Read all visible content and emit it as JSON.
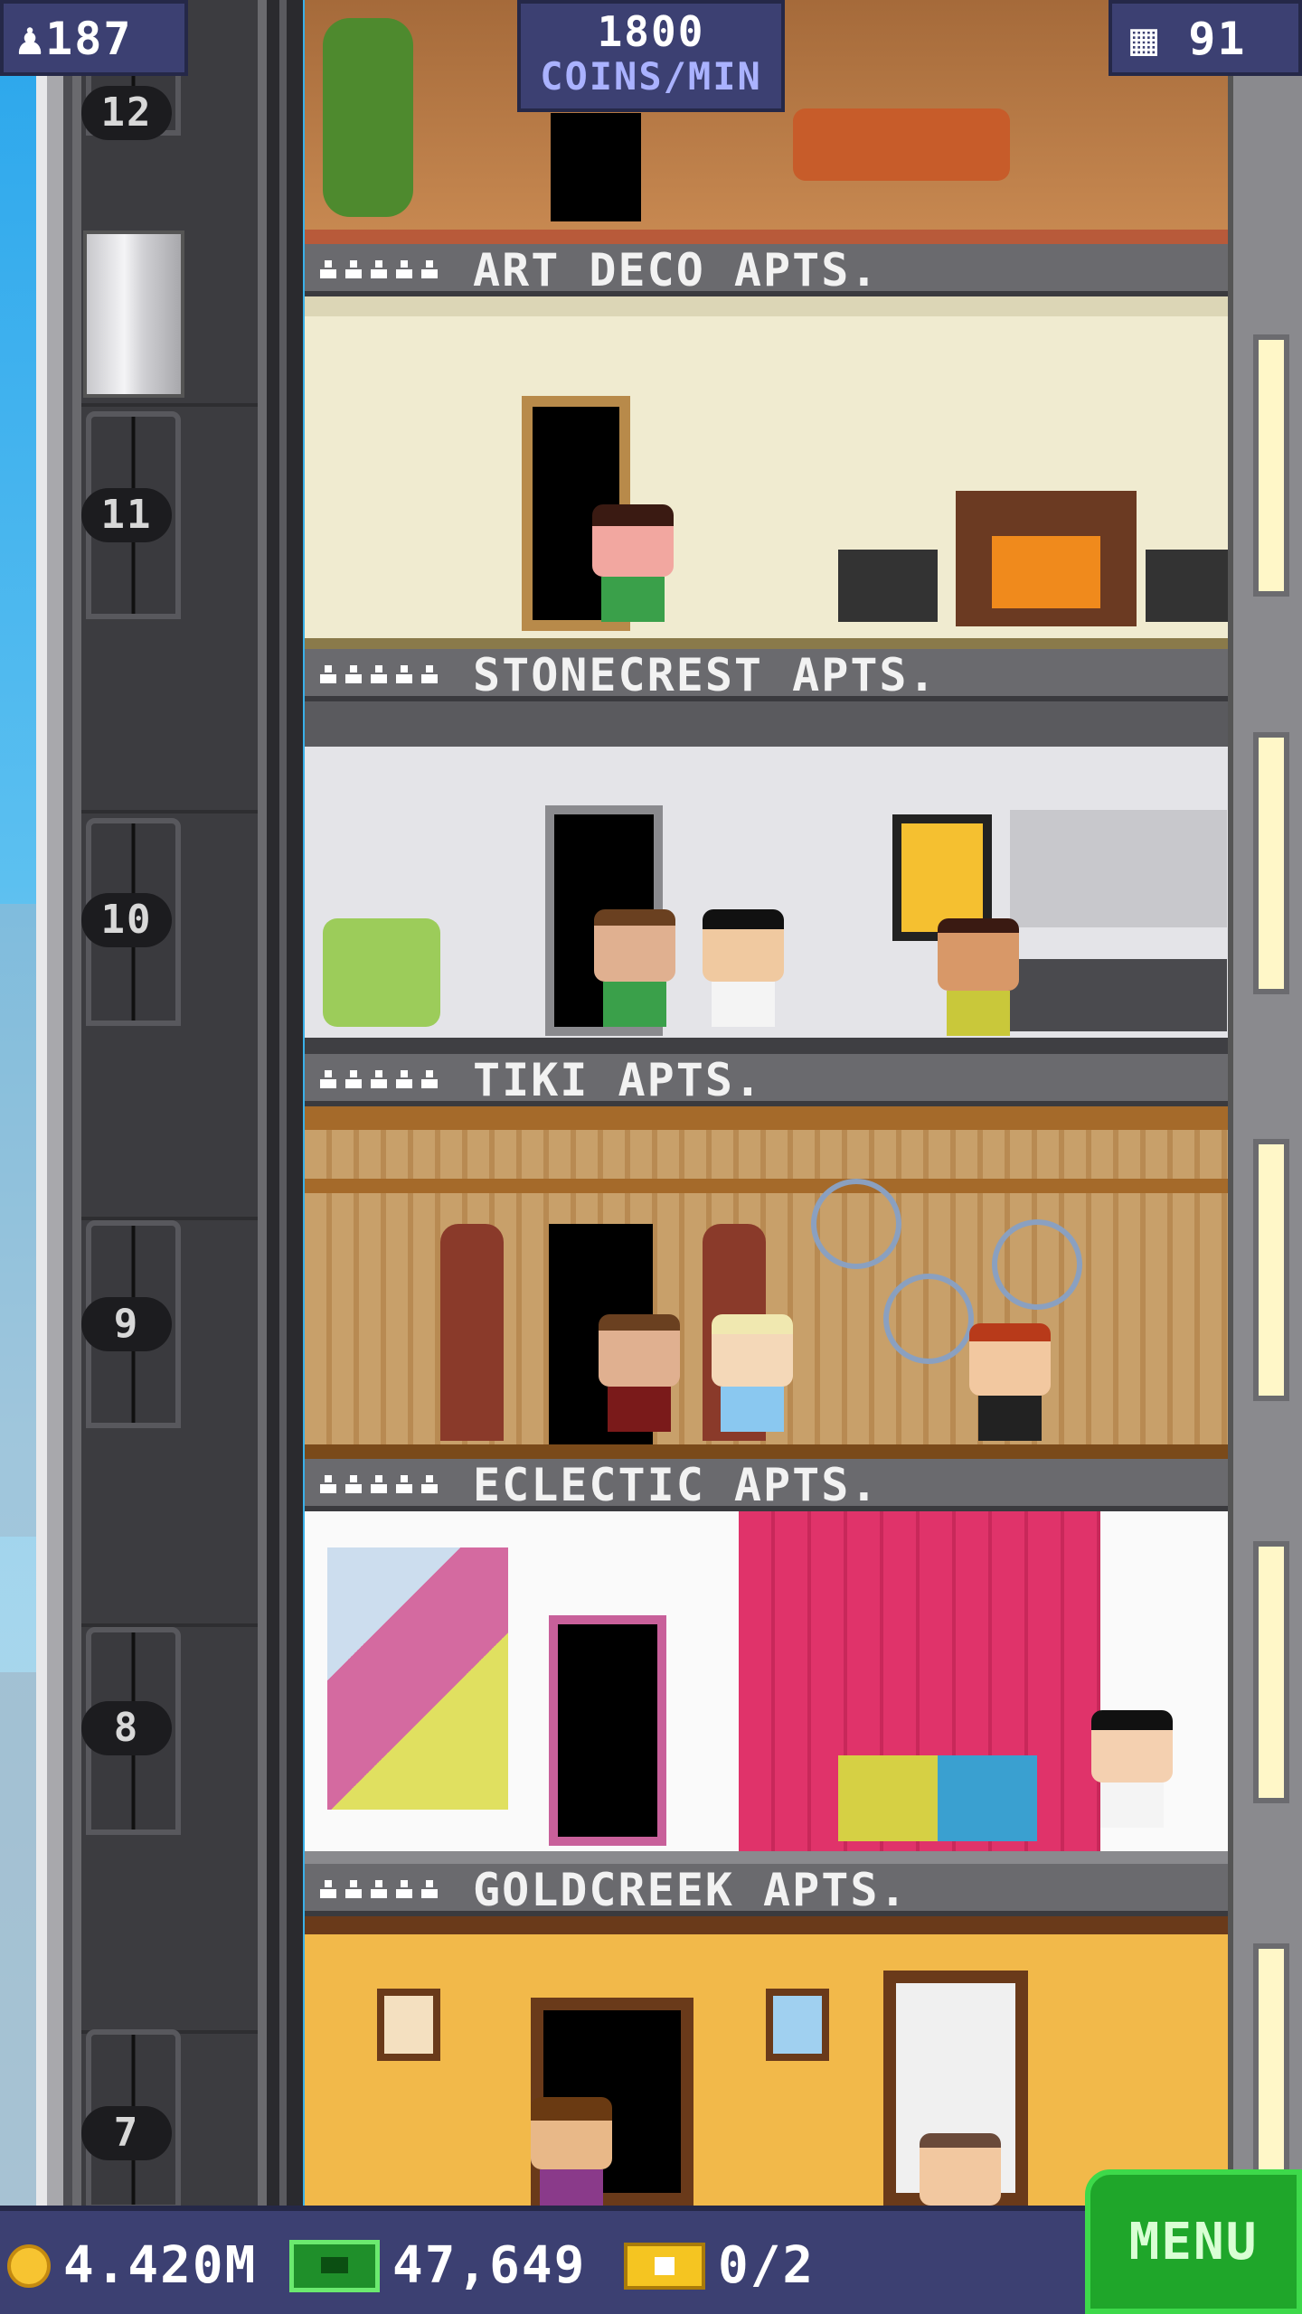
{
  "hud": {
    "population": "187",
    "coins_per_min_value": "1800",
    "coins_per_min_label": "COINS/MIN",
    "floor_count": "91"
  },
  "floors": [
    {
      "number": "12",
      "name": "ART DECO APTS."
    },
    {
      "number": "11",
      "name": "STONECREST APTS."
    },
    {
      "number": "10",
      "name": "TIKI APTS."
    },
    {
      "number": "9",
      "name": "ECLECTIC APTS."
    },
    {
      "number": "8",
      "name": "GOLDCREEK APTS."
    },
    {
      "number": "7",
      "name": ""
    }
  ],
  "bottom_bar": {
    "coins": "4.420M",
    "tower_bux": "47,649",
    "tickets": "0/2",
    "menu_label": "MENU"
  },
  "icons": [
    "population-icon",
    "floors-icon",
    "zoom-icon",
    "coin-icon",
    "tower-bux-icon",
    "ticket-icon"
  ],
  "colors": {
    "hud_bg": "#3c4072",
    "menu_bg": "#1fa62a",
    "sky": "#2aa6ec"
  }
}
